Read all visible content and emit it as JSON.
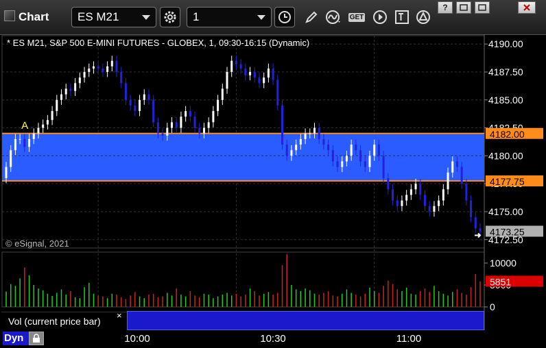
{
  "window": {
    "title": "Chart",
    "symbol": "ES M21",
    "interval": "1",
    "window_buttons": [
      "?",
      "restore",
      "minimize",
      "close"
    ]
  },
  "toolbar": {
    "icons": [
      "settings-gear-icon",
      "clock-icon",
      "pencil-draw-icon",
      "study-curve-icon",
      "get-button-icon",
      "play-icon",
      "text-tool-icon",
      "alert-triangle-icon"
    ],
    "get_label": "GET"
  },
  "chart": {
    "panel_title": "* ES M21, S&P 500 E-MINI FUTURES - GLOBEX, 1, 09:30-16:15 (Dynamic)",
    "copyright": "© eSignal, 2021",
    "annotation_label": "A",
    "price_ticks": [
      "4190.00",
      "4187.50",
      "4185.00",
      "4182.50",
      "4180.00",
      "4177.50",
      "4175.00",
      "4172.50"
    ],
    "upper_level": "4182.00",
    "lower_level": "4177.75",
    "last_price": "4173.25",
    "volume_ticks": [
      "10000",
      "5000",
      "0"
    ],
    "volume_last": "5851",
    "volume_panel_label": "Vol (current price bar)",
    "volume_close": "×",
    "time_ticks": [
      "10:00",
      "10:30",
      "11:00"
    ],
    "interval_mode": "Dyn",
    "colors": {
      "background": "#000000",
      "band": "#2b5cff",
      "level_line": "#ff8c1a",
      "up_candle": "#ffffff",
      "down_candle": "#2222dd",
      "volume_up": "#22cc22",
      "volume_down": "#cc2222",
      "last_price_bg": "#b0b0b0",
      "volume_last_bg": "#dd0000"
    }
  },
  "chart_data": {
    "type": "candlestick",
    "x": [
      "09:40",
      "09:41",
      "09:42",
      "09:43",
      "09:44",
      "09:45",
      "09:46",
      "09:47",
      "09:48",
      "09:49",
      "09:50",
      "09:51",
      "09:52",
      "09:53",
      "09:54",
      "09:55",
      "09:56",
      "09:57",
      "09:58",
      "09:59",
      "10:00",
      "10:01",
      "10:02",
      "10:03",
      "10:04",
      "10:05",
      "10:06",
      "10:07",
      "10:08",
      "10:09",
      "10:10",
      "10:11",
      "10:12",
      "10:13",
      "10:14",
      "10:15",
      "10:16",
      "10:17",
      "10:18",
      "10:19",
      "10:20",
      "10:21",
      "10:22",
      "10:23",
      "10:24",
      "10:25",
      "10:26",
      "10:27",
      "10:28",
      "10:29",
      "10:30",
      "10:31",
      "10:32",
      "10:33",
      "10:34",
      "10:35",
      "10:36",
      "10:37",
      "10:38",
      "10:39",
      "10:40",
      "10:41",
      "10:42",
      "10:43",
      "10:44",
      "10:45",
      "10:46",
      "10:47",
      "10:48",
      "10:49",
      "10:50",
      "10:51",
      "10:52",
      "10:53",
      "10:54",
      "10:55",
      "10:56",
      "10:57",
      "10:58",
      "10:59",
      "11:00",
      "11:01",
      "11:02",
      "11:03",
      "11:04",
      "11:05",
      "11:06",
      "11:07",
      "11:08",
      "11:09",
      "11:10",
      "11:11",
      "11:12",
      "11:13",
      "11:14"
    ],
    "open": [
      4178.0,
      4179.0,
      4180.5,
      4181.5,
      4181.5,
      4180.8,
      4181.5,
      4182.0,
      4182.5,
      4182.8,
      4183.2,
      4184.0,
      4185.0,
      4185.5,
      4186.0,
      4185.8,
      4186.5,
      4187.0,
      4187.5,
      4187.8,
      4188.0,
      4187.8,
      4187.5,
      4188.0,
      4188.5,
      4187.5,
      4186.5,
      4185.0,
      4184.5,
      4184.0,
      4185.0,
      4185.5,
      4185.0,
      4183.0,
      4182.0,
      4181.8,
      4182.5,
      4183.0,
      4182.5,
      4183.5,
      4184.0,
      4183.5,
      4182.5,
      4182.0,
      4182.5,
      4183.0,
      4184.0,
      4185.0,
      4186.0,
      4187.5,
      4188.5,
      4188.2,
      4187.8,
      4187.2,
      4187.5,
      4187.0,
      4186.5,
      4187.0,
      4187.8,
      4186.8,
      4184.5,
      4181.0,
      4180.0,
      4180.5,
      4181.0,
      4181.5,
      4182.0,
      4182.0,
      4182.5,
      4181.5,
      4181.0,
      4180.5,
      4179.5,
      4179.0,
      4179.5,
      4180.0,
      4181.0,
      4180.5,
      4179.5,
      4179.0,
      4180.0,
      4181.0,
      4180.0,
      4178.0,
      4177.0,
      4176.0,
      4175.5,
      4176.0,
      4176.5,
      4177.0,
      4177.5,
      4176.5,
      4175.5,
      4175.0,
      4175.5,
      4176.0,
      4177.0,
      4178.5,
      4179.5,
      4179.0,
      4177.5,
      4176.0,
      4174.5,
      4173.5
    ],
    "close": [
      4179.0,
      4180.5,
      4181.5,
      4181.5,
      4180.8,
      4181.5,
      4182.0,
      4182.5,
      4182.8,
      4183.2,
      4184.0,
      4185.0,
      4185.5,
      4186.0,
      4185.8,
      4186.5,
      4187.0,
      4187.5,
      4187.8,
      4188.0,
      4187.8,
      4187.5,
      4188.0,
      4188.5,
      4187.5,
      4186.5,
      4185.0,
      4184.5,
      4184.0,
      4185.0,
      4185.5,
      4185.0,
      4183.0,
      4182.0,
      4181.8,
      4182.5,
      4183.0,
      4182.5,
      4183.5,
      4184.0,
      4183.5,
      4182.5,
      4182.0,
      4182.5,
      4183.0,
      4184.0,
      4185.0,
      4186.0,
      4187.5,
      4188.5,
      4188.2,
      4187.8,
      4187.2,
      4187.5,
      4187.0,
      4186.5,
      4187.0,
      4187.8,
      4186.8,
      4184.5,
      4181.0,
      4180.0,
      4180.5,
      4181.0,
      4181.5,
      4182.0,
      4182.0,
      4182.5,
      4181.5,
      4181.0,
      4180.5,
      4179.5,
      4179.0,
      4179.5,
      4180.0,
      4181.0,
      4180.5,
      4179.5,
      4179.0,
      4180.0,
      4181.0,
      4180.0,
      4178.0,
      4177.0,
      4176.0,
      4175.5,
      4176.0,
      4176.5,
      4177.0,
      4177.5,
      4176.5,
      4175.5,
      4175.0,
      4175.5,
      4176.0,
      4177.0,
      4178.5,
      4179.5,
      4179.0,
      4177.5,
      4176.0,
      4174.5,
      4173.5,
      4173.25
    ],
    "band": [
      4177.75,
      4182.0
    ],
    "volume": [
      3500,
      5200,
      4800,
      6500,
      9000,
      7200,
      5000,
      4200,
      3800,
      3000,
      2500,
      3200,
      4000,
      2800,
      3600,
      2200,
      2000,
      4500,
      5500,
      3000,
      2600,
      2400,
      2000,
      3000,
      2800,
      2200,
      1800,
      2600,
      3400,
      2400,
      2000,
      2800,
      3000,
      2200,
      2400,
      3200,
      2600,
      4200,
      2800,
      2400,
      3600,
      2600,
      2200,
      3000,
      2800,
      2000,
      2400,
      2800,
      3200,
      2600,
      3000,
      2400,
      2800,
      4200,
      3600,
      2600,
      3000,
      3400,
      2800,
      3200,
      9500,
      12000,
      5000,
      4000,
      3600,
      4200,
      3800,
      3000,
      2800,
      3200,
      3600,
      2600,
      2400,
      3000,
      4000,
      3200,
      2800,
      2400,
      3000,
      4400,
      3600,
      3200,
      4800,
      6000,
      5200,
      4000,
      3600,
      4400,
      3000,
      2800,
      3600,
      4200,
      3400,
      4800,
      3600,
      3000,
      2600,
      3400,
      4000,
      3200,
      2800,
      4500,
      7500,
      5851
    ],
    "ylim": [
      4171.75,
      4190.75
    ],
    "volume_ylim": [
      0,
      12500
    ],
    "grid": true
  }
}
